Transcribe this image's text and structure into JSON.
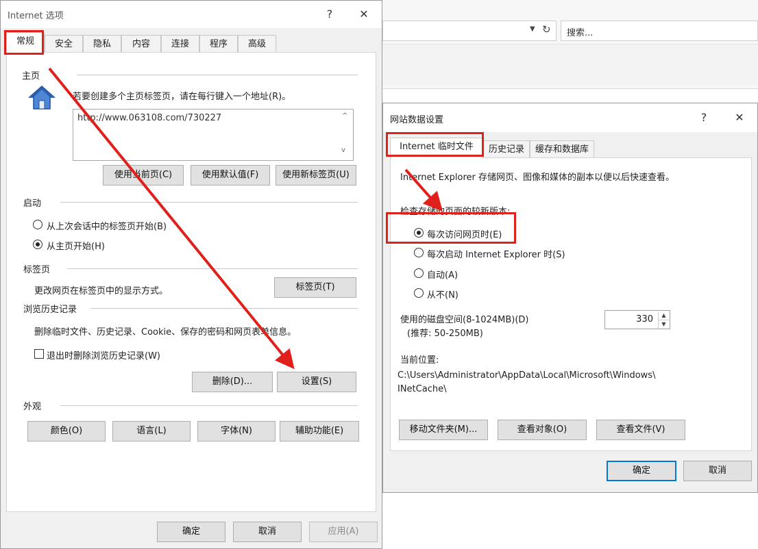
{
  "browser": {
    "search_placeholder": "搜索..."
  },
  "internet_options": {
    "title": "Internet 选项",
    "help": "?",
    "close": "✕",
    "tabs": [
      "常规",
      "安全",
      "隐私",
      "内容",
      "连接",
      "程序",
      "高级"
    ],
    "homepage": {
      "group": "主页",
      "desc": "若要创建多个主页标签页，请在每行键入一个地址(R)。",
      "url": "http://www.063108.com/730227",
      "btn_current": "使用当前页(C)",
      "btn_default": "使用默认值(F)",
      "btn_newtab": "使用新标签页(U)"
    },
    "startup": {
      "group": "启动",
      "opt_last": "从上次会话中的标签页开始(B)",
      "opt_home": "从主页开始(H)"
    },
    "tabs_group": {
      "group": "标签页",
      "desc": "更改网页在标签页中的显示方式。",
      "btn": "标签页(T)"
    },
    "history": {
      "group": "浏览历史记录",
      "desc": "删除临时文件、历史记录、Cookie、保存的密码和网页表单信息。",
      "check_label": "退出时删除浏览历史记录(W)",
      "btn_delete": "删除(D)...",
      "btn_settings": "设置(S)"
    },
    "appearance": {
      "group": "外观",
      "btn_colors": "颜色(O)",
      "btn_languages": "语言(L)",
      "btn_fonts": "字体(N)",
      "btn_access": "辅助功能(E)"
    },
    "footer": {
      "ok": "确定",
      "cancel": "取消",
      "apply": "应用(A)"
    }
  },
  "website_data": {
    "title": "网站数据设置",
    "help": "?",
    "close": "✕",
    "tabs": [
      "Internet 临时文件",
      "历史记录",
      "缓存和数据库"
    ],
    "desc": "Internet Explorer 存储网页、图像和媒体的副本以便以后快速查看。",
    "check_label": "检查存储的页面的较新版本:",
    "options": [
      "每次访问网页时(E)",
      "每次启动 Internet Explorer 时(S)",
      "自动(A)",
      "从不(N)"
    ],
    "disk_label": "使用的磁盘空间(8-1024MB)(D)",
    "disk_hint": "(推荐: 50-250MB)",
    "disk_value": "330",
    "location_label": "当前位置:",
    "location_path1": "C:\\Users\\Administrator\\AppData\\Local\\Microsoft\\Windows\\",
    "location_path2": "INetCache\\",
    "btn_move": "移动文件夹(M)...",
    "btn_objects": "查看对象(O)",
    "btn_files": "查看文件(V)",
    "ok": "确定",
    "cancel": "取消"
  }
}
